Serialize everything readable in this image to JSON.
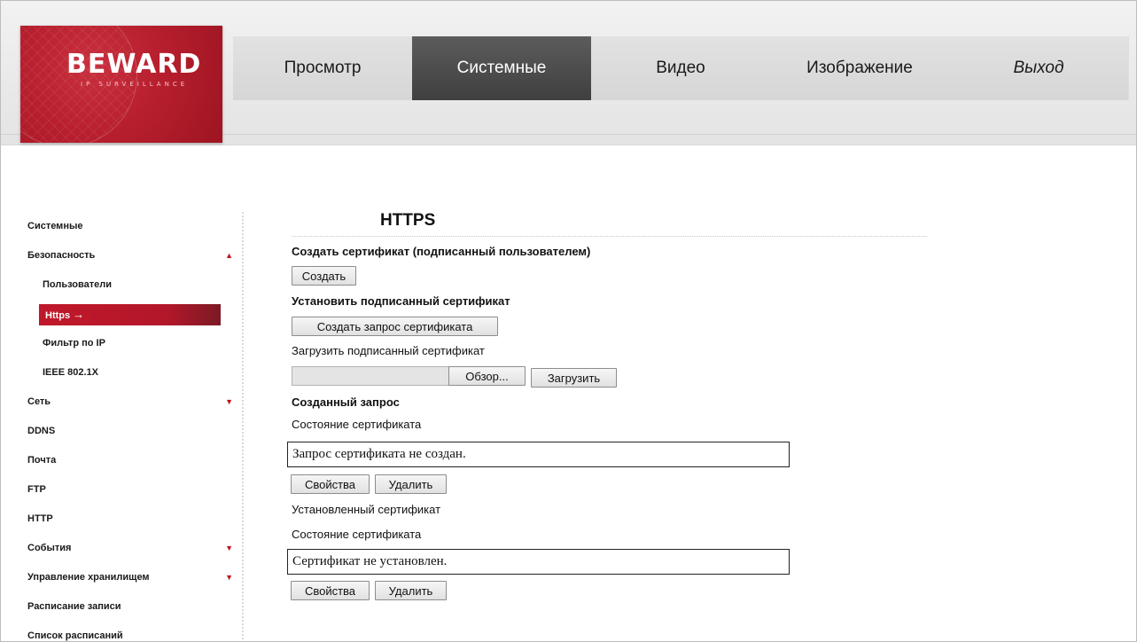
{
  "logo": {
    "brand": "BEWARD",
    "tagline": "IP SURVEILLANCE"
  },
  "nav": {
    "tabs": [
      {
        "label": "Просмотр"
      },
      {
        "label": "Системные"
      },
      {
        "label": "Видео"
      },
      {
        "label": "Изображение"
      },
      {
        "label": "Выход"
      }
    ],
    "active_tab": "Системные"
  },
  "sidebar": {
    "items": [
      {
        "label": "Системные"
      },
      {
        "label": "Безопасность",
        "arrow": "▲"
      },
      {
        "label": "Пользователи"
      },
      {
        "label": "Https",
        "suffix": "→"
      },
      {
        "label": "Фильтр по IP"
      },
      {
        "label": "IEEE 802.1X"
      },
      {
        "label": "Сеть",
        "arrow": "▼"
      },
      {
        "label": "DDNS"
      },
      {
        "label": "Почта"
      },
      {
        "label": "FTP"
      },
      {
        "label": "HTTP"
      },
      {
        "label": "События",
        "arrow": "▼"
      },
      {
        "label": "Управление хранилищем",
        "arrow": "▼"
      },
      {
        "label": "Расписание записи"
      },
      {
        "label": "Список расписаний"
      }
    ],
    "active_item": "Https"
  },
  "main": {
    "title": "HTTPS",
    "create_cert_heading": "Создать сертификат (подписанный пользователем)",
    "create_button": "Создать",
    "install_heading": "Установить подписанный сертификат",
    "create_request_button": "Создать запрос сертификата",
    "upload_label": "Загрузить подписанный сертификат",
    "browse_button": "Обзор...",
    "upload_button": "Загрузить",
    "created_request_heading": "Созданный запрос",
    "cert_status_label_1": "Состояние сертификата",
    "cert_status_value_1": "Запрос сертификата не создан.",
    "properties_button_1": "Свойства",
    "delete_button_1": "Удалить",
    "installed_cert_label": "Установленный сертификат",
    "cert_status_label_2": "Состояние сертификата",
    "cert_status_value_2": "Сертификат не установлен.",
    "properties_button_2": "Свойства",
    "delete_button_2": "Удалить"
  },
  "colors": {
    "accent_red": "#b81f2e",
    "active_tab_bg": "#4a4a4a",
    "sidebar_arrow": "#c1121f"
  }
}
